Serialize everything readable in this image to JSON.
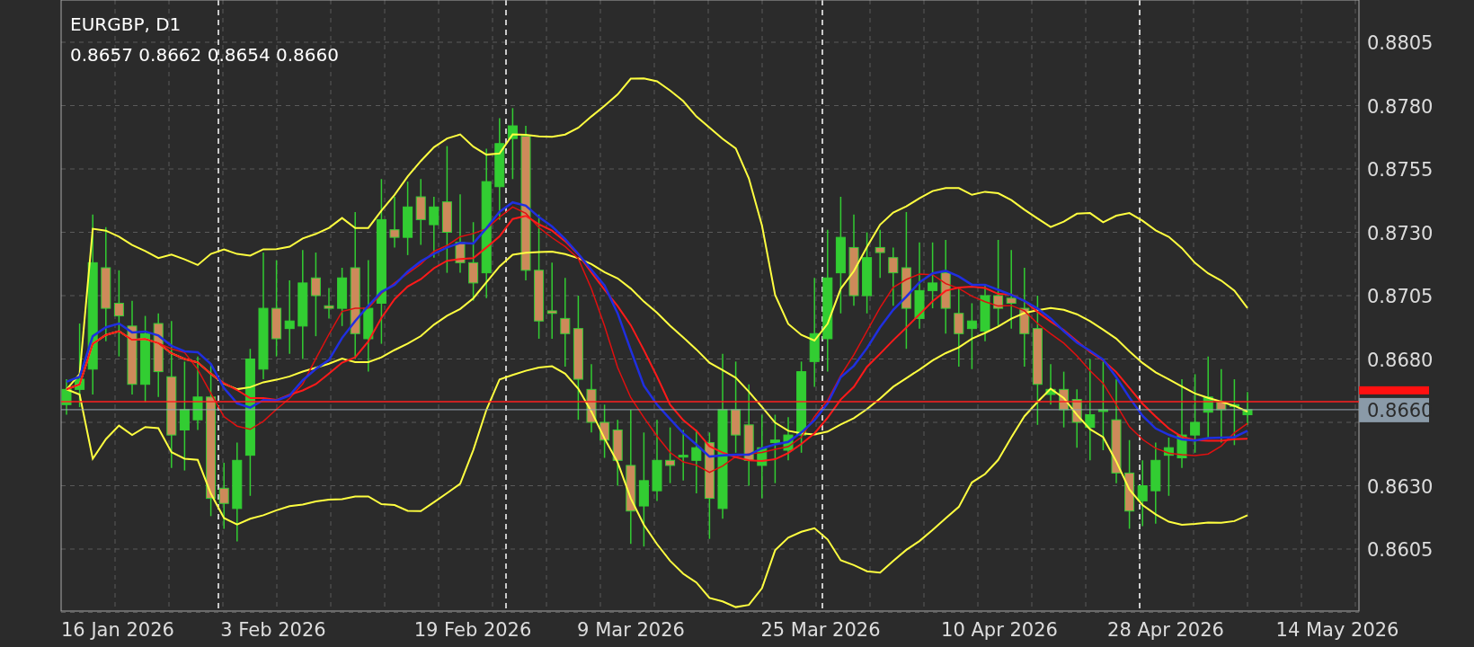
{
  "chart": {
    "symbol": "EURGBP, D1",
    "ohlc": "0.8657 0.8662 0.8654 0.8660",
    "current_price": "0.8660"
  },
  "price_axis": {
    "labels": [
      "0.8805",
      "0.8780",
      "0.8755",
      "0.8730",
      "0.8705",
      "0.8680",
      "0.8630",
      "0.8605"
    ]
  },
  "time_axis": {
    "labels": [
      "16 Jan 2026",
      "3 Feb 2026",
      "19 Feb 2026",
      "9 Mar 2026",
      "25 Mar 2026",
      "10 Apr 2026",
      "28 Apr 2026",
      "14 May 2026"
    ]
  }
}
